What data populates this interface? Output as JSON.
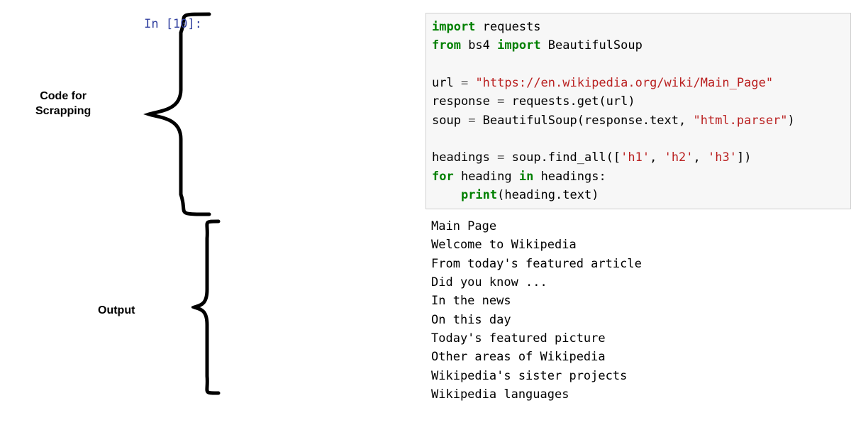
{
  "prompt": "In [10]:",
  "labels": {
    "code": "Code for\nScrapping",
    "output": "Output"
  },
  "code": {
    "l1": {
      "import": "import",
      "requests": " requests"
    },
    "l2": {
      "from": "from",
      "bs4": " bs4 ",
      "imp": "import",
      "beau": " BeautifulSoup"
    },
    "l3": "",
    "l4": {
      "a": "url ",
      "eq": "=",
      "s": " \"https://en.wikipedia.org/wiki/Main_Page\""
    },
    "l5": {
      "a": "response ",
      "eq": "=",
      "b": " requests.get(url)"
    },
    "l6": {
      "a": "soup ",
      "eq": "=",
      "b": " BeautifulSoup(response.text, ",
      "s": "\"html.parser\"",
      "c": ")"
    },
    "l7": "",
    "l8": {
      "a": "headings ",
      "eq": "=",
      "b": " soup.find_all([",
      "s1": "'h1'",
      "c1": ", ",
      "s2": "'h2'",
      "c2": ", ",
      "s3": "'h3'",
      "c3": "])"
    },
    "l9": {
      "for": "for",
      "a": " heading ",
      "in": "in",
      "b": " headings:"
    },
    "l10": {
      "indent": "    ",
      "print": "print",
      "args": "(heading.text)"
    }
  },
  "output": {
    "lines": [
      "Main Page",
      "Welcome to Wikipedia",
      "From today's featured article",
      "Did you know ...",
      "In the news",
      "On this day",
      "Today's featured picture",
      "Other areas of Wikipedia",
      "Wikipedia's sister projects",
      "Wikipedia languages"
    ]
  }
}
